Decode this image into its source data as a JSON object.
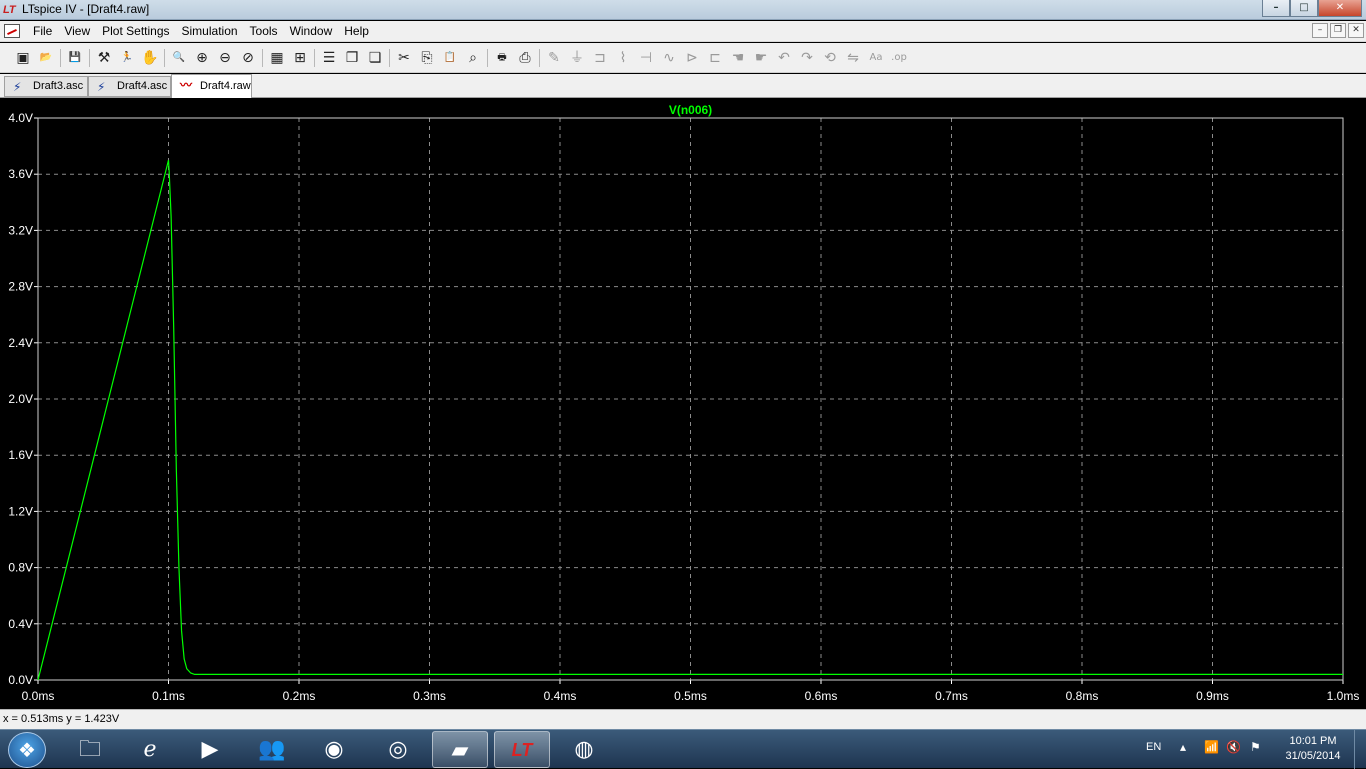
{
  "window": {
    "title": "LTspice IV - [Draft4.raw]",
    "app_icon": "ltspice-logo-icon"
  },
  "window_controls": {
    "minimize": "–",
    "maximize": "□",
    "close": "✕"
  },
  "menubar": {
    "items": [
      "File",
      "View",
      "Plot Settings",
      "Simulation",
      "Tools",
      "Window",
      "Help"
    ]
  },
  "mdi_controls": {
    "minimize": "–",
    "restore": "❐",
    "close": "✕"
  },
  "toolbar": {
    "tools": [
      {
        "icon": "new-schematic-icon",
        "glyph": "▣"
      },
      {
        "icon": "open-icon",
        "glyph": "📂"
      },
      {
        "icon": "save-icon",
        "glyph": "💾"
      },
      {
        "icon": "control-panel-icon",
        "glyph": "⚒"
      },
      {
        "icon": "run-icon",
        "glyph": "🏃"
      },
      {
        "icon": "halt-icon",
        "glyph": "✋"
      },
      {
        "icon": "zoom-in-icon",
        "glyph": "🔍"
      },
      {
        "icon": "pan-icon",
        "glyph": "⊕"
      },
      {
        "icon": "zoom-out-icon",
        "glyph": "⊖"
      },
      {
        "icon": "zoom-fit-icon",
        "glyph": "⊘"
      },
      {
        "icon": "autorange-icon",
        "glyph": "▦"
      },
      {
        "icon": "grid-icon",
        "glyph": "⊞"
      },
      {
        "icon": "tile-horizontal-icon",
        "glyph": "☰"
      },
      {
        "icon": "cascade-icon",
        "glyph": "❐"
      },
      {
        "icon": "tile-vertical-icon",
        "glyph": "❏"
      },
      {
        "icon": "cut-icon",
        "glyph": "✂"
      },
      {
        "icon": "copy-icon",
        "glyph": "⎘"
      },
      {
        "icon": "paste-icon",
        "glyph": "📋"
      },
      {
        "icon": "find-icon",
        "glyph": "⌕"
      },
      {
        "icon": "print-setup-icon",
        "glyph": "🖶"
      },
      {
        "icon": "print-icon",
        "glyph": "⎙"
      },
      {
        "icon": "wire-icon",
        "glyph": "✎"
      },
      {
        "icon": "ground-icon",
        "glyph": "⏚"
      },
      {
        "icon": "label-net-icon",
        "glyph": "⊐"
      },
      {
        "icon": "resistor-icon",
        "glyph": "⌇"
      },
      {
        "icon": "capacitor-icon",
        "glyph": "⊣"
      },
      {
        "icon": "inductor-icon",
        "glyph": "∿"
      },
      {
        "icon": "diode-icon",
        "glyph": "⊳"
      },
      {
        "icon": "component-icon",
        "glyph": "⊏"
      },
      {
        "icon": "move-icon",
        "glyph": "☚"
      },
      {
        "icon": "drag-icon",
        "glyph": "☛"
      },
      {
        "icon": "undo-icon",
        "glyph": "↶"
      },
      {
        "icon": "redo-icon",
        "glyph": "↷"
      },
      {
        "icon": "rotate-icon",
        "glyph": "⟲"
      },
      {
        "icon": "mirror-icon",
        "glyph": "⇋"
      },
      {
        "icon": "text-icon",
        "glyph": "Aa"
      },
      {
        "icon": "spice-directive-icon",
        "glyph": ".op"
      }
    ]
  },
  "tabs": [
    {
      "label": "Draft3.asc",
      "icon": "schematic-icon",
      "active": false
    },
    {
      "label": "Draft4.asc",
      "icon": "schematic-icon",
      "active": false
    },
    {
      "label": "Draft4.raw",
      "icon": "waveform-icon",
      "active": true
    }
  ],
  "colors": {
    "trace": "#00ff00",
    "background": "#000000",
    "grid": "#8c8c8c",
    "axis_text": "#ffffff"
  },
  "chart_data": {
    "type": "line",
    "title": "V(n006)",
    "xlabel": "",
    "ylabel": "",
    "xlim": [
      0.0,
      1.0
    ],
    "ylim": [
      0.0,
      4.0
    ],
    "x_ticks": [
      "0.0ms",
      "0.1ms",
      "0.2ms",
      "0.3ms",
      "0.4ms",
      "0.5ms",
      "0.6ms",
      "0.7ms",
      "0.8ms",
      "0.9ms",
      "1.0ms"
    ],
    "y_ticks": [
      "0.0V",
      "0.4V",
      "0.8V",
      "1.2V",
      "1.6V",
      "2.0V",
      "2.4V",
      "2.8V",
      "3.2V",
      "3.6V",
      "4.0V"
    ],
    "grid": true,
    "series": [
      {
        "name": "V(n006)",
        "x": [
          0.0,
          0.05,
          0.1,
          0.1005,
          0.102,
          0.104,
          0.106,
          0.108,
          0.11,
          0.112,
          0.114,
          0.117,
          0.12,
          0.13,
          0.2,
          0.5,
          1.0
        ],
        "y": [
          0.0,
          1.85,
          3.7,
          3.62,
          3.3,
          2.5,
          1.5,
          0.8,
          0.35,
          0.15,
          0.08,
          0.05,
          0.04,
          0.04,
          0.04,
          0.04,
          0.04
        ]
      }
    ]
  },
  "statusbar": {
    "cursor_readout": "x = 0.513ms    y = 1.423V"
  },
  "taskbar": {
    "apps": [
      {
        "icon": "file-explorer-icon",
        "glyph": "🗀",
        "active": false
      },
      {
        "icon": "internet-explorer-icon",
        "glyph": "ℯ",
        "active": false
      },
      {
        "icon": "media-player-icon",
        "glyph": "▶",
        "active": false
      },
      {
        "icon": "messenger-icon",
        "glyph": "👥",
        "active": false
      },
      {
        "icon": "picasa-icon",
        "glyph": "◉",
        "active": false
      },
      {
        "icon": "chrome-icon",
        "glyph": "◎",
        "active": false
      },
      {
        "icon": "sticky-notes-icon",
        "glyph": "▰",
        "active": true
      },
      {
        "icon": "ltspice-icon",
        "glyph": "LT",
        "active": true
      },
      {
        "icon": "firefox-icon",
        "glyph": "◍",
        "active": false
      }
    ],
    "tray": {
      "language": "EN",
      "time": "10:01 PM",
      "date": "31/05/2014"
    }
  }
}
